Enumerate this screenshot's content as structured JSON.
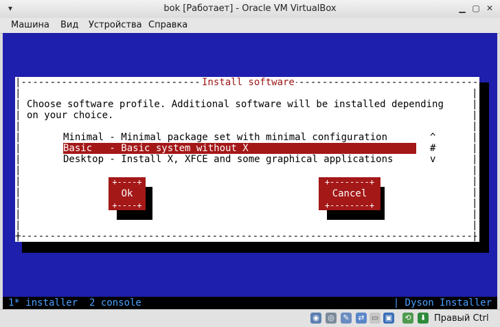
{
  "window": {
    "title": "bok [Работает] - Oracle VM VirtualBox"
  },
  "menu": [
    "Машина",
    "Вид",
    "Устройства",
    "Справка"
  ],
  "dialog": {
    "title": "Install software",
    "prompt_line1": "Choose software profile. Additional software will be installed depending",
    "prompt_line2": "on your choice.",
    "options": [
      "Minimal - Minimal package set with minimal configuration",
      "Basic   - Basic system without X",
      "Desktop - Install X, XFCE and some graphical applications"
    ],
    "selected_index": 1,
    "scroll_up": "^",
    "scroll_thumb": "#",
    "scroll_down": "v",
    "ok_label": "Ok",
    "cancel_label": "Cancel"
  },
  "vm_status": {
    "left": "1* installer  2 console",
    "right": "| Dyson Installer"
  },
  "host_status": {
    "host_key_label": "Правый Ctrl"
  },
  "colors": {
    "vm_background": "#1f1fad",
    "accent_red": "#a41818",
    "status_text": "#4aa0ff"
  }
}
